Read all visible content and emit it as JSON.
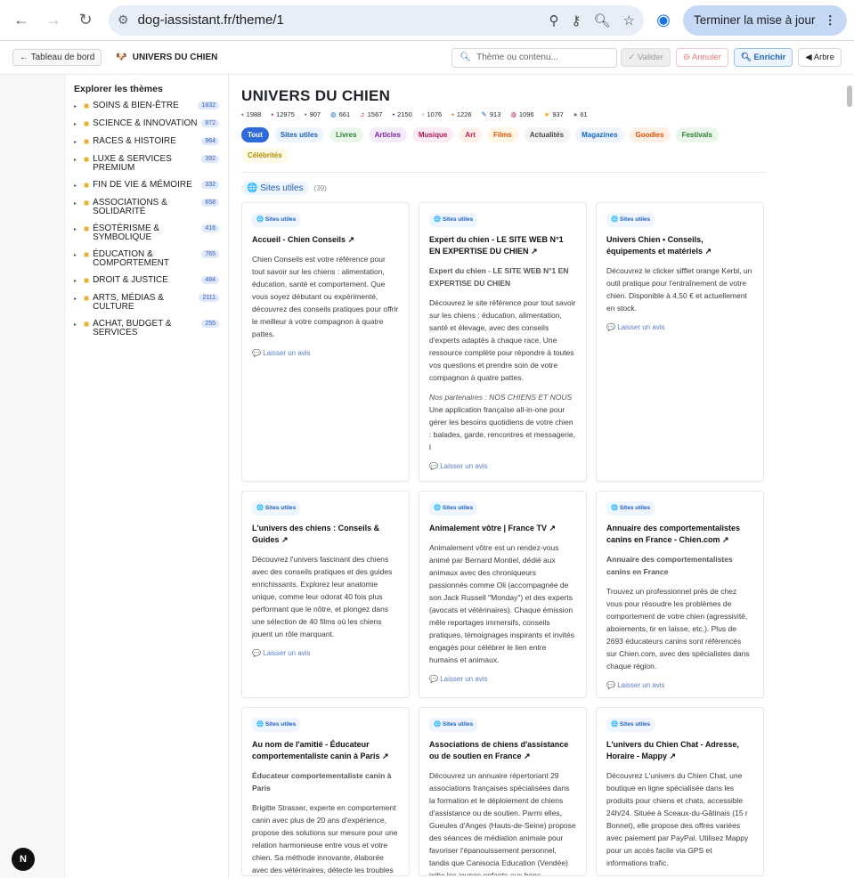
{
  "browser": {
    "url": "dog-iassistant.fr/theme/1",
    "update_label": "Terminer la mise à jour"
  },
  "toolbar": {
    "back_label": "← Tableau de bord",
    "title": "UNIVERS DU CHIEN",
    "search_placeholder": "Thème ou contenu...",
    "validate": "Valider",
    "cancel": "Annuler",
    "enrich": "Enrichir",
    "tree": "◀ Arbre"
  },
  "sidebar": {
    "heading": "Explorer les thèmes",
    "items": [
      {
        "label": "SOINS & BIEN-ÊTRE",
        "count": "1832"
      },
      {
        "label": "SCIENCE & INNOVATION",
        "count": "872"
      },
      {
        "label": "RACES & HISTOIRE",
        "count": "964"
      },
      {
        "label": "LUXE & SERVICES PREMIUM",
        "count": "392"
      },
      {
        "label": "FIN DE VIE & MÉMOIRE",
        "count": "332"
      },
      {
        "label": "ASSOCIATIONS & SOLIDARITÉ",
        "count": "658"
      },
      {
        "label": "ÉSOTÉRISME & SYMBOLIQUE",
        "count": "416"
      },
      {
        "label": "ÉDUCATION & COMPORTEMENT",
        "count": "765"
      },
      {
        "label": "DROIT & JUSTICE",
        "count": "484"
      },
      {
        "label": "ARTS, MÉDIAS & CULTURE",
        "count": "2111"
      },
      {
        "label": "ACHAT, BUDGET & SERVICES",
        "count": "255"
      }
    ]
  },
  "page": {
    "title": "UNIVERS DU CHIEN"
  },
  "stats": [
    {
      "value": "1988",
      "color": "#2e7d32"
    },
    {
      "value": "12975",
      "color": "#7b1fa2"
    },
    {
      "value": "907",
      "color": "#2e7d32"
    },
    {
      "value": "661",
      "color": "#1565c0"
    },
    {
      "value": "1567",
      "color": "#ad1457"
    },
    {
      "value": "2150",
      "color": "#6a1b9a"
    },
    {
      "value": "1076",
      "color": "#555555"
    },
    {
      "value": "1226",
      "color": "#e65100"
    },
    {
      "value": "913",
      "color": "#1565c0"
    },
    {
      "value": "1096",
      "color": "#ad1457"
    },
    {
      "value": "937",
      "color": "#f9a825"
    },
    {
      "value": "61",
      "color": "#8d6e63"
    }
  ],
  "tabs": [
    {
      "label": "Tout",
      "bg": "#2e6ad8",
      "fg": "#ffffff"
    },
    {
      "label": "Sites utiles",
      "bg": "#eef5ff",
      "fg": "#1e5eb5"
    },
    {
      "label": "Livres",
      "bg": "#eaf7ea",
      "fg": "#2e7d32"
    },
    {
      "label": "Articles",
      "bg": "#f4ecfb",
      "fg": "#7b1fa2"
    },
    {
      "label": "Musique",
      "bg": "#fdecf3",
      "fg": "#ad1457"
    },
    {
      "label": "Art",
      "bg": "#fff0ea",
      "fg": "#c2185b"
    },
    {
      "label": "Films",
      "bg": "#fff7e6",
      "fg": "#e65100"
    },
    {
      "label": "Actualités",
      "bg": "#f4f4f4",
      "fg": "#444444"
    },
    {
      "label": "Magazines",
      "bg": "#eef5ff",
      "fg": "#1565c0"
    },
    {
      "label": "Goodies",
      "bg": "#fff0e6",
      "fg": "#e65100"
    },
    {
      "label": "Festivals",
      "bg": "#eaf7ea",
      "fg": "#2e7d32"
    },
    {
      "label": "Célébrités",
      "bg": "#fffbe6",
      "fg": "#b28704"
    }
  ],
  "section": {
    "name": "Sites utiles",
    "count": "(39)"
  },
  "cards": [
    {
      "badge": "Sites utiles",
      "title": "Accueil - Chien Conseils ↗",
      "sub": "",
      "paragraphs": [
        "Chien Conseils est votre référence pour tout savoir sur les chiens : alimentation, éducation, santé et comportement. Que vous soyez débutant ou expérimenté, découvrez des conseils pratiques pour offrir le meilleur à votre compagnon à quatre pattes."
      ],
      "italic": "",
      "extra": "",
      "avis": "Laisser un avis"
    },
    {
      "badge": "Sites utiles",
      "title": "Expert du chien - LE SITE WEB N°1 EN EXPERTISE DU CHIEN ↗",
      "sub": "Expert du chien - LE SITE WEB N°1 EN EXPERTISE DU CHIEN",
      "paragraphs": [
        "Découvrez le site référence pour tout savoir sur les chiens : éducation, alimentation, santé et élevage, avec des conseils d'experts adaptés à chaque race. Une ressource complète pour répondre à toutes vos questions et prendre soin de votre compagnon à quatre pattes."
      ],
      "italic": "Nos partenaires : NOS CHIENS ET NOUS",
      "extra": "Une application française all-in-one pour gérer les besoins quotidiens de votre chien : balades, garde, rencontres et messagerie, l",
      "avis": "Laisser un avis"
    },
    {
      "badge": "Sites utiles",
      "title": "Univers Chien • Conseils, équipements et matériels ↗",
      "sub": "",
      "paragraphs": [
        "Découvrez le clicker sifflet orange Kerbl, un outil pratique pour l'entraînement de votre chien. Disponible à 4,50 € et actuellement en stock."
      ],
      "italic": "",
      "extra": "",
      "avis": "Laisser un avis"
    },
    {
      "badge": "Sites utiles",
      "title": "L'univers des chiens : Conseils & Guides ↗",
      "sub": "",
      "paragraphs": [
        "Découvrez l'univers fascinant des chiens avec des conseils pratiques et des guides enrichissants. Explorez leur anatomie unique, comme leur odorat 40 fois plus performant que le nôtre, et plongez dans une sélection de 40 films où les chiens jouent un rôle marquant."
      ],
      "italic": "",
      "extra": "",
      "avis": "Laisser un avis"
    },
    {
      "badge": "Sites utiles",
      "title": "Animalement vôtre | France TV ↗",
      "sub": "",
      "paragraphs": [
        "Animalement vôtre est un rendez-vous animé par Bernard Montiel, dédié aux animaux avec des chroniqueurs passionnés comme Oli (accompagnée de son Jack Russell \"Monday\") et des experts (avocats et vétérinaires). Chaque émission mêle reportages immersifs, conseils pratiques, témoignages inspirants et invités engagés pour célébrer le lien entre humains et animaux."
      ],
      "italic": "",
      "extra": "",
      "avis": "Laisser un avis"
    },
    {
      "badge": "Sites utiles",
      "title": "Annuaire des comportementalistes canins en France - Chien.com ↗",
      "sub": "Annuaire des comportementalistes canins en France",
      "paragraphs": [
        "Trouvez un professionnel près de chez vous pour résoudre les problèmes de comportement de votre chien (agressivité, aboiements, tir en laisse, etc.). Plus de 2693 éducateurs canins sont référencés sur Chien.com, avec des spécialistes dans chaque région."
      ],
      "italic": "",
      "extra": "",
      "avis": "Laisser un avis"
    },
    {
      "badge": "Sites utiles",
      "title": "Au nom de l'amitié - Éducateur comportementaliste canin à Paris ↗",
      "sub": "Éducateur comportementaliste canin à Paris",
      "paragraphs": [
        "Brigitte Strasser, experte en comportement canin avec plus de 20 ans d'expérience, propose des solutions sur mesure pour une relation harmonieuse entre vous et votre chien. Sa méthode innovante, élaborée avec des vétérinaires, détecte les troubles"
      ],
      "italic": "",
      "extra": "",
      "avis": ""
    },
    {
      "badge": "Sites utiles",
      "title": "Associations de chiens d'assistance ou de soutien en France ↗",
      "sub": "",
      "paragraphs": [
        "Découvrez un annuaire répertoriant 29 associations françaises spécialisées dans la formation et le déploiement de chiens d'assistance ou de soutien. Parmi elles, Gueules d'Anges (Hauts-de-Seine) propose des séances de médiation animale pour favoriser l'épanouissement personnel, tandis que Canisocia Education (Vendée) initie les jeunes enfants aux bons"
      ],
      "italic": "",
      "extra": "",
      "avis": ""
    },
    {
      "badge": "Sites utiles",
      "title": "L'univers du Chien Chat - Adresse, Horaire - Mappy ↗",
      "sub": "",
      "paragraphs": [
        "Découvrez L'univers du Chien Chat, une boutique en ligne spécialisée dans les produits pour chiens et chats, accessible 24h/24. Située à Sceaux-du-Gâtinais (15 r Bonnet), elle propose des offres variées avec paiement par PayPal. Utilisez Mappy pour un accès facile via GPS et informations trafic."
      ],
      "italic": "",
      "extra": "",
      "avis": ""
    }
  ]
}
